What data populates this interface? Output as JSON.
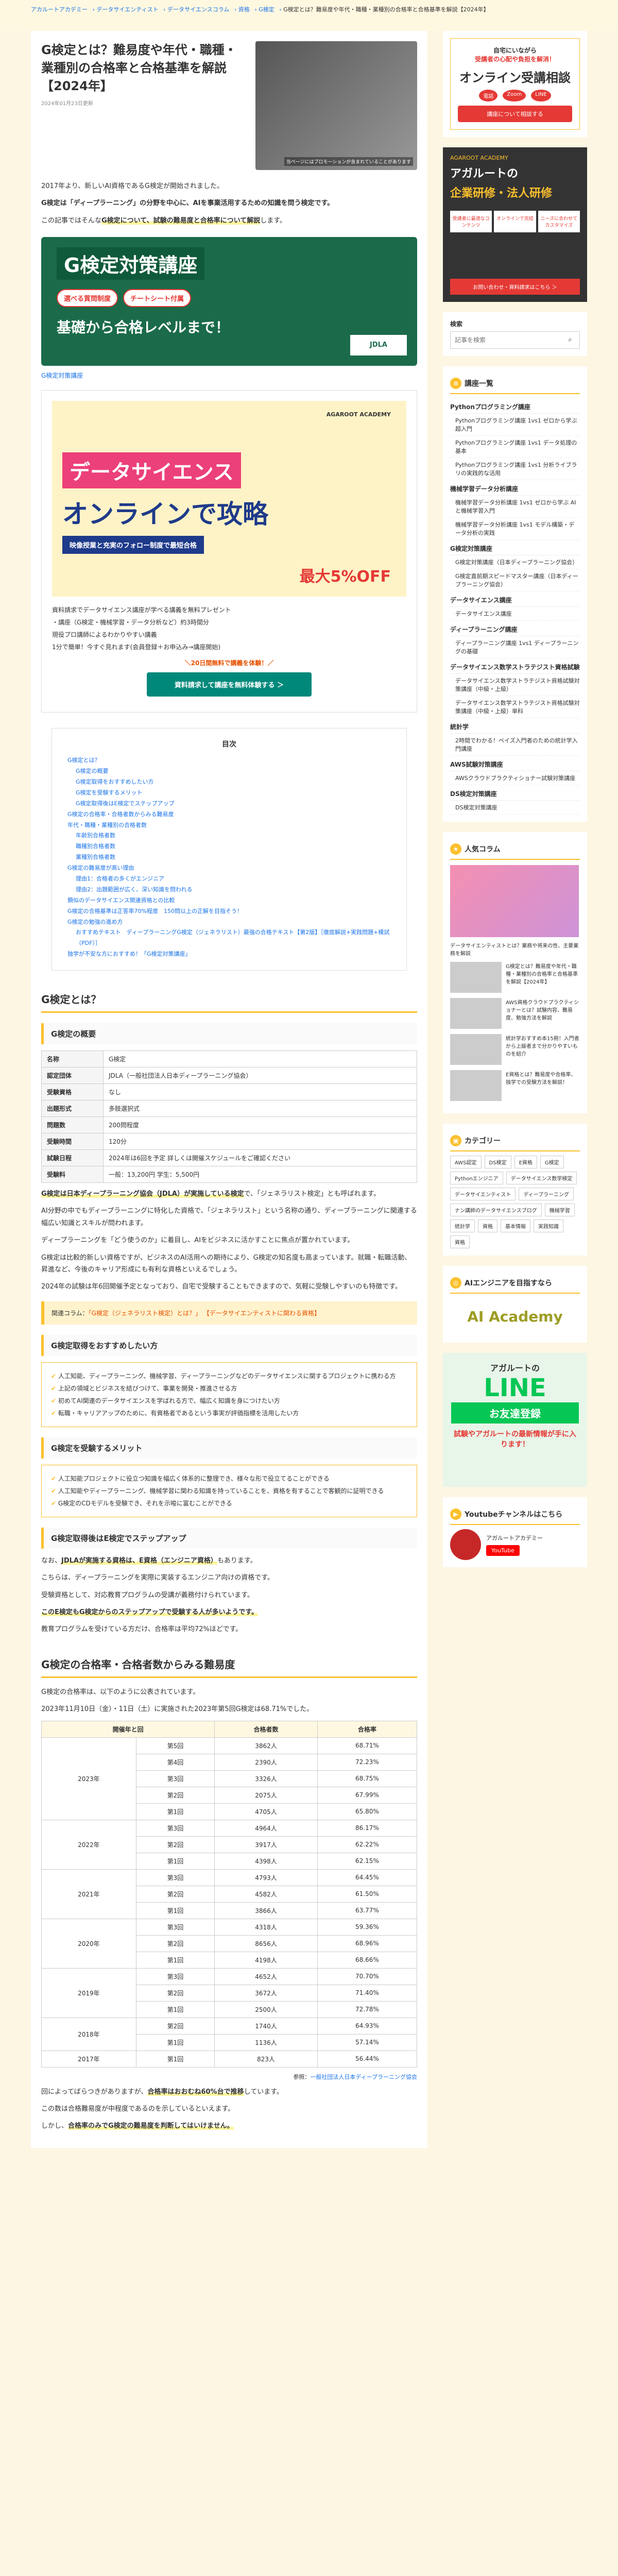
{
  "breadcrumb": [
    "アカルートアカデミー",
    "データサイエンティスト",
    "データサイエンスコラム",
    "資格",
    "G検定",
    "G検定とは？難易度や年代・職種・業種別の合格率と合格基準を解説【2024年】"
  ],
  "article": {
    "title": "G検定とは？難易度や年代・職種・業種別の合格率と合格基準を解説【2024年】",
    "date": "2024年01月23日更新",
    "hero_caption": "当ページにはプロモーションが含まれていることがあります",
    "intro1": "2017年より、新しいAI資格であるG検定が開始されました。",
    "intro2": "G検定は「ディープラーニング」の分野を中心に、AIを事業活用するための知識を問う検定です。",
    "intro3_pre": "この記事ではそんな",
    "intro3_hl": "G検定について、試験の難易度と合格率について解説",
    "intro3_post": "します。",
    "banner_title": "G検定対策講座",
    "banner_tag1": "選べる質問制度",
    "banner_tag2": "チートシート付属",
    "banner_sub": "基礎から合格レベルまで！",
    "banner_logo": "JDLA",
    "banner_link": "G検定対策講座",
    "promo_brand": "AGAROOT ACADEMY",
    "promo_ds": "データサイエンス",
    "promo_on": "オンラインで攻略",
    "promo_sub": "映像授業と充実のフォロー制度で最短合格",
    "promo_off": "最大5%OFF",
    "promo_points": [
      "資料請求でデータサイエンス講座が学べる講義を無料プレゼント",
      "・講座（G検定・機械学習・データ分析など）約3時間分",
      "現役プロ講師によるわかりやすい講義",
      "1分で簡単！今すぐ見れます(会員登録＋お申込み→講座開始)"
    ],
    "promo_note": "＼20日間無料で講義を体験！／",
    "promo_cta": "資料請求して講座を無料体験する ＞"
  },
  "toc": {
    "title": "目次",
    "items": [
      {
        "t": "G検定とは？",
        "lv": 1
      },
      {
        "t": "G検定の概要",
        "lv": 2
      },
      {
        "t": "G検定取得をおすすめしたい方",
        "lv": 2
      },
      {
        "t": "G検定を受験するメリット",
        "lv": 2
      },
      {
        "t": "G検定取得後はE検定でステップアップ",
        "lv": 2
      },
      {
        "t": "G検定の合格率・合格者数からみる難易度",
        "lv": 1
      },
      {
        "t": "年代・職種・業種別の合格者数",
        "lv": 1
      },
      {
        "t": "年齢別合格者数",
        "lv": 2
      },
      {
        "t": "職種別合格者数",
        "lv": 2
      },
      {
        "t": "業種別合格者数",
        "lv": 2
      },
      {
        "t": "G検定の難易度が高い理由",
        "lv": 1
      },
      {
        "t": "理由1：合格者の多くがエンジニア",
        "lv": 2
      },
      {
        "t": "理由2：出題範囲が広く、深い知識を問われる",
        "lv": 2
      },
      {
        "t": "類似のデータサイエンス関連資格との比較",
        "lv": 1
      },
      {
        "t": "G検定の合格基準は正答率70%程度　150問以上の正解を目指そう！",
        "lv": 1
      },
      {
        "t": "G検定の勉強の進め方",
        "lv": 1
      },
      {
        "t": "おすすめテキスト　ディープラーニングG検定（ジェネラリスト）最強の合格テキスト【第2版】［徹底解説+実践問題+模試（PDF）］",
        "lv": 2
      },
      {
        "t": "独学が不安な方におすすめ！「G検定対策講座」",
        "lv": 1
      }
    ]
  },
  "sec1": {
    "h2": "G検定とは？",
    "h3a": "G検定の概要",
    "table": [
      [
        "名称",
        "G検定"
      ],
      [
        "認定団体",
        "JDLA（一般社団法人日本ディープラーニング協会）"
      ],
      [
        "受験資格",
        "なし"
      ],
      [
        "出題形式",
        "多肢選択式"
      ],
      [
        "問題数",
        "200問程度"
      ],
      [
        "受験時間",
        "120分"
      ],
      [
        "試験日程",
        "2024年は6回を予定 詳しくは開催スケジュールをご確認ください"
      ],
      [
        "受験料",
        "一般：13,200円 学生：5,500円"
      ]
    ],
    "p1_hl": "G検定は日本ディープラーニング協会（JDLA）が実施している検定",
    "p1_rest": "で、「ジェネラリスト検定」とも呼ばれます。",
    "p2": "AI分野の中でもディープラーニングに特化した資格で、「ジェネラリスト」という名称の通り、ディープラーニングに関連する幅広い知識とスキルが問われます。",
    "p3": "ディープラーニングを「どう使うのか」に着目し、AIをビジネスに活かすことに焦点が置かれています。",
    "p4": "G検定は比較的新しい資格ですが、ビジネスのAI活用への期待により、G検定の知名度も高まっています。就職・転職活動、昇進など、今後のキャリア形成にも有利な資格といえるでしょう。",
    "p5": "2024年の試験は年6回開催予定となっており、自宅で受験することもできますので、気軽に受験しやすいのも特徴です。",
    "note_pre": "関連コラム：",
    "note_link1": "「G検定（ジェネラリスト検定）とは？」",
    "note_link2": "【データサイエンティストに関わる資格】",
    "h3b": "G検定取得をおすすめしたい方",
    "recommend": [
      "人工知能、ディープラーニング、機械学習、ディープラーニングなどのデータサイエンスに関するプロジェクトに携わる方",
      "上記の領域とビジネスを結びつけて、事業を開発・推進させる方",
      "初めてAI関連のデータサイエンスを学ばれる方で、幅広く知識を身につけたい方",
      "転職・キャリアアップのために、有資格者であるという事実が評価指標を活用したい方"
    ],
    "h3c": "G検定を受験するメリット",
    "merits": [
      "人工知能プロジェクトに役立つ知識を幅広く体系的に整理でき、様々な形で役立てることができる",
      "人工知能やディープラーニング、機械学習に関わる知識を持っていることを、資格を有することで客観的に証明できる",
      "G検定のCDモデルを受験でき、それを示唆に富むことができる"
    ],
    "h3d": "G検定取得後はE検定でステップアップ",
    "p6_pre": "なお、",
    "p6_hl": "JDLAが実施する資格は、E資格（エンジニア資格）",
    "p6_post": "もあります。",
    "p7": "こちらは、ディープラーニングを実際に実装するエンジニア向けの資格です。",
    "p8": "受験資格として、対応教育プログラムの受講が義務付けられています。",
    "p9_hl": "このE検定もG検定からのステップアップで受験する人が多いようです。",
    "p10": "教育プログラムを受けている方だけ、合格率は平均72%ほどです。"
  },
  "sec2": {
    "h2": "G検定の合格率・合格者数からみる難易度",
    "p1": "G検定の合格率は、以下のように公表されています。",
    "p2": "2023年11月10日（金）・11日（土）に実施された2023年第5回G検定は68.71%でした。",
    "headers": [
      "開催年と回",
      "",
      "合格者数",
      "合格率"
    ],
    "rows": [
      {
        "year": "2023年",
        "items": [
          [
            "第5回",
            "3862人",
            "68.71%"
          ],
          [
            "第4回",
            "2390人",
            "72.23%"
          ],
          [
            "第3回",
            "3326人",
            "68.75%"
          ],
          [
            "第2回",
            "2075人",
            "67.99%"
          ],
          [
            "第1回",
            "4705人",
            "65.80%"
          ]
        ]
      },
      {
        "year": "2022年",
        "items": [
          [
            "第3回",
            "4964人",
            "86.17%"
          ],
          [
            "第2回",
            "3917人",
            "62.22%"
          ],
          [
            "第1回",
            "4398人",
            "62.15%"
          ]
        ]
      },
      {
        "year": "2021年",
        "items": [
          [
            "第3回",
            "4793人",
            "64.45%"
          ],
          [
            "第2回",
            "4582人",
            "61.50%"
          ],
          [
            "第1回",
            "3866人",
            "63.77%"
          ]
        ]
      },
      {
        "year": "2020年",
        "items": [
          [
            "第3回",
            "4318人",
            "59.36%"
          ],
          [
            "第2回",
            "8656人",
            "68.96%"
          ],
          [
            "第1回",
            "4198人",
            "68.66%"
          ]
        ]
      },
      {
        "year": "2019年",
        "items": [
          [
            "第3回",
            "4652人",
            "70.70%"
          ],
          [
            "第2回",
            "3672人",
            "71.40%"
          ],
          [
            "第1回",
            "2500人",
            "72.78%"
          ]
        ]
      },
      {
        "year": "2018年",
        "items": [
          [
            "第2回",
            "1740人",
            "64.93%"
          ],
          [
            "第1回",
            "1136人",
            "57.14%"
          ]
        ]
      },
      {
        "year": "2017年",
        "items": [
          [
            "第1回",
            "823人",
            "56.44%"
          ]
        ]
      }
    ],
    "src_pre": "参照：",
    "src_link": "一般社団法人日本ディープラーニング協会",
    "p3_pre": "回によってばらつきがありますが、",
    "p3_hl": "合格率はおおむね60%台で推移",
    "p3_post": "しています。",
    "p4": "この数は合格難易度が中程度であるのを示しているといえます。",
    "p5_pre": "しかし、",
    "p5_hl": "合格率のみでG検定の難易度を判断してはいけません。"
  },
  "sidebar": {
    "ad1": {
      "t1": "自宅にいながら",
      "hl": "受講者の心配や負担を解消！",
      "t2": "オンライン受講相談",
      "icons": [
        "電話",
        "Zoom",
        "LINE"
      ],
      "btn": "講座について相談する"
    },
    "ad2": {
      "brand": "AGAROOT ACADEMY",
      "t1": "アガルートの",
      "big": "企業研修・法人研修",
      "grid": [
        "受講者に最適なコンテンツ",
        "オンラインで完結",
        "ニーズに合わせてカスタマイズ"
      ],
      "btn": "お問い合わせ・資料請求はこちら ＞"
    },
    "search_label": "検索",
    "search_placeholder": "記事を検索",
    "courses_h": "講座一覧",
    "courses": [
      {
        "cat": "Pythonプログラミング講座",
        "subs": [
          "Pythonプログラミング講座 1vs1 ゼロから学ぶ超入門",
          "Pythonプログラミング講座 1vs1 データ処理の基本",
          "Pythonプログラミング講座 1vs1 分析ライブラリの実践的な活用"
        ]
      },
      {
        "cat": "機械学習データ分析講座",
        "subs": [
          "機械学習データ分析講座 1vs1 ゼロから学ぶ AIと機械学習入門",
          "機械学習データ分析講座 1vs1 モデル構築・データ分析の実践"
        ]
      },
      {
        "cat": "G検定対策講座",
        "subs": [
          "G検定対策講座（日本ディープラーニング協会）",
          "G検定直前期スピードマスター講座（日本ディープラーニング協会）"
        ]
      },
      {
        "cat": "データサイエンス講座",
        "subs": [
          "データサイエンス講座"
        ]
      },
      {
        "cat": "ディープラーニング講座",
        "subs": [
          "ディープラーニング講座 1vs1 ディープラーニングの基礎"
        ]
      },
      {
        "cat": "データサイエンス数学ストラテジスト資格試験",
        "subs": [
          "データサイエンス数学ストラテジスト資格試験対策講座（中級・上級）",
          "データサイエンス数学ストラテジスト資格試験対策講座（中級・上級）単科"
        ]
      },
      {
        "cat": "統計学",
        "subs": [
          "2時間でわかる！ベイズ入門者のための統計学入門講座"
        ]
      },
      {
        "cat": "AWS試験対策講座",
        "subs": [
          "AWSクラウドプラクティショナー試験対策講座"
        ]
      },
      {
        "cat": "DS検定対策講座",
        "subs": [
          "DS検定対策講座"
        ]
      }
    ],
    "popular_h": "人気コラム",
    "popular": [
      "データサイエンティストとは？業務や将来の性、主要業務を解説",
      "G検定とは？難易度や年代・職種・業種別の合格率と合格基準を解説【2024年】",
      "AWS資格クラウドプラクティショナーとは？試験内容、難易度、勉強方法を解説",
      "統計学おすすめ本15冊！入門者から上級者まで分かりやすいものを紹介",
      "E資格とは？難易度や合格率、独学での受験方法を解説！"
    ],
    "cats_h": "カテゴリー",
    "cats": [
      "AWS認定",
      "DS検定",
      "E資格",
      "G検定",
      "Pythonエンジニア",
      "データサイエンス数学検定",
      "データサイエンティスト",
      "ディープラーニング",
      "ナン講師のデータサイエンスブログ",
      "機械学習",
      "統計学",
      "資格",
      "基本情報",
      "実践知識",
      "資格"
    ],
    "ai_h": "AIエンジニアを目指すなら",
    "ai_logo": "AI Academy",
    "line": {
      "l1": "アガルートの",
      "l2": "LINE",
      "l3": "お友達登録",
      "l4": "試験やアガルートの最新情報が手に入ります！"
    },
    "yt_h": "Youtubeチャンネルはこちら",
    "yt_name": "アガルートアカデミー",
    "yt_btn": "YouTube"
  },
  "colors": {
    "accent": "#fbc02d",
    "link": "#1a73e8",
    "primary_green": "#1b6b4a",
    "cta": "#00897b"
  }
}
